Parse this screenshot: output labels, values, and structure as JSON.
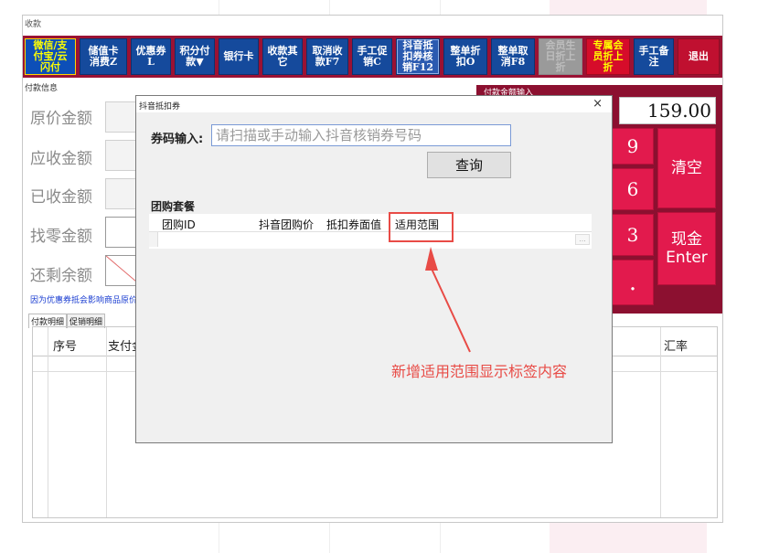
{
  "window": {
    "title": "收款"
  },
  "toolbar": {
    "buttons": [
      {
        "label": "微信/支\n付宝/云\n闪付"
      },
      {
        "label": "储值卡\n消费Z"
      },
      {
        "label": "优惠券\nL"
      },
      {
        "label": "积分付\n款▼"
      },
      {
        "label": "银行卡"
      },
      {
        "label": "收款其\n它"
      },
      {
        "label": "取消收\n款F7"
      },
      {
        "label": "手工促\n销C"
      },
      {
        "label": "抖音抵\n扣券核\n销F12"
      },
      {
        "label": "整单折\n扣O"
      },
      {
        "label": "整单取\n消F8"
      },
      {
        "label": "会员生\n日折上\n折"
      },
      {
        "label": "专属会\n员折上\n折"
      },
      {
        "label": "手工备\n注"
      },
      {
        "label": "退出"
      }
    ]
  },
  "payment_info": {
    "section_label": "付款信息",
    "fields": [
      "原价金额",
      "应收金额",
      "已收金额",
      "找零金额",
      "还剩余额"
    ],
    "note": "因为优惠券抵会影响商品原价"
  },
  "tabs": [
    "付款明细",
    "促销明细"
  ],
  "detail_grid": {
    "columns": [
      "序号",
      "支付金",
      "汇率"
    ]
  },
  "keypad": {
    "title": "付款金额输入",
    "amount": "159.00",
    "keys": {
      "nine": "9",
      "six": "6",
      "three": "3",
      "dot": ".",
      "clear": "清空",
      "cash": "现金\nEnter"
    }
  },
  "dialog": {
    "title": "抖音抵扣券",
    "close": "×",
    "coupon_label": "券码输入:",
    "coupon_placeholder": "请扫描或手动输入抖音核销券号码",
    "query_button": "查询",
    "group_label": "团购套餐",
    "columns": [
      "团购ID",
      "抖音团购价",
      "抵扣券面值",
      "适用范围"
    ],
    "row_ellipsis": "..."
  },
  "annotation": {
    "text": "新增适用范围显示标签内容",
    "color": "#e84b46"
  },
  "colors": {
    "toolbar_bg": "#9a1234",
    "button_blue": "#154a9c",
    "key_red": "#e21a4d"
  }
}
